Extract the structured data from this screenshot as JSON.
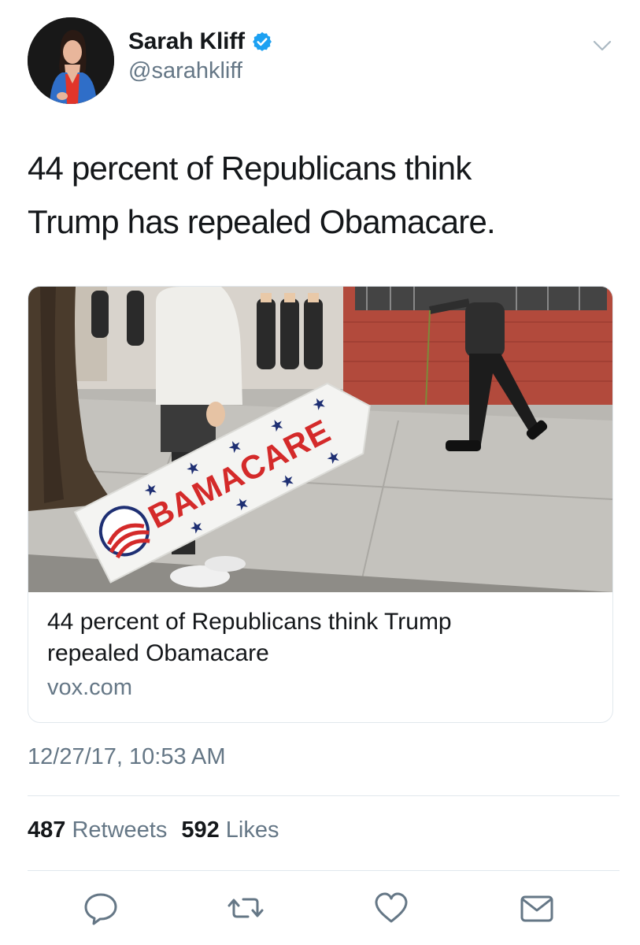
{
  "user": {
    "display_name": "Sarah Kliff",
    "handle": "@sarahkliff",
    "verified": true
  },
  "tweet": {
    "text_line1": "44 percent of Republicans think",
    "text_line2": "Trump has repealed Obamacare.",
    "timestamp": "12/27/17, 10:53 AM"
  },
  "card": {
    "title_line1": "44 percent of Republicans think Trump",
    "title_line2": "repealed Obamacare",
    "domain": "vox.com",
    "sign_text": "BAMACARE"
  },
  "stats": {
    "retweets_count": "487",
    "retweets_label": "Retweets",
    "likes_count": "592",
    "likes_label": "Likes"
  },
  "icons": {
    "verified": "verified-badge-icon",
    "menu": "chevron-down-icon",
    "reply": "reply-icon",
    "retweet": "retweet-icon",
    "like": "heart-icon",
    "dm": "envelope-icon"
  },
  "colors": {
    "accent": "#1da1f2",
    "text": "#14171a",
    "secondary": "#657786",
    "border": "#e1e8ed",
    "action_icon": "#657786"
  }
}
